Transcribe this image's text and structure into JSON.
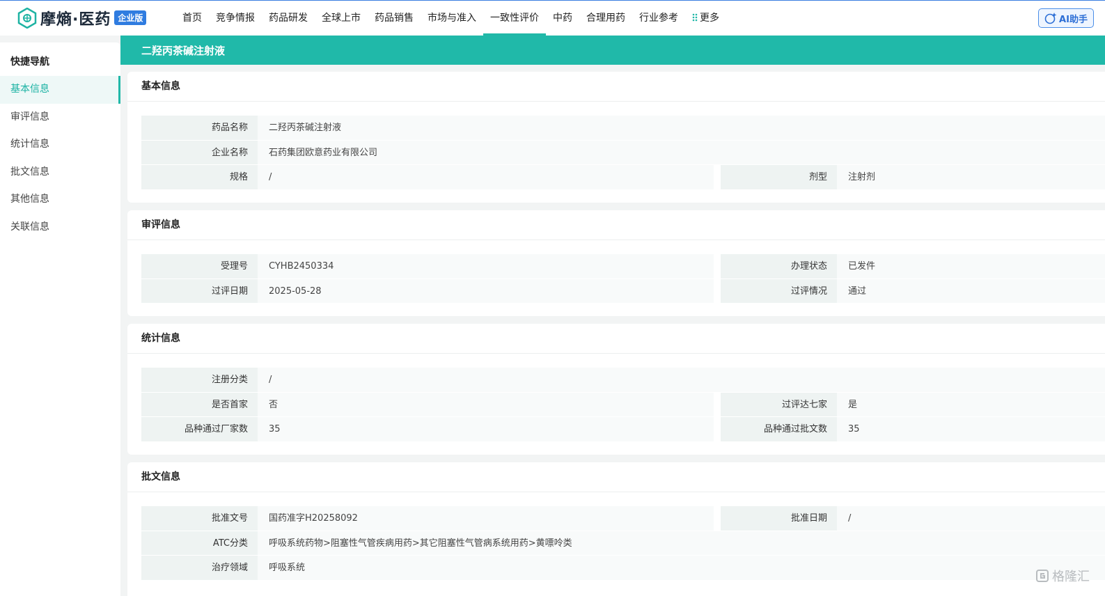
{
  "brand": {
    "name": "摩熵·医药",
    "badge": "企业版"
  },
  "nav": {
    "items": [
      "首页",
      "竞争情报",
      "药品研发",
      "全球上市",
      "药品销售",
      "市场与准入",
      "一致性评价",
      "中药",
      "合理用药",
      "行业参考"
    ],
    "more": "更多",
    "ai_label": "AI助手"
  },
  "sidebar": {
    "title": "快捷导航",
    "items": [
      "基本信息",
      "审评信息",
      "统计信息",
      "批文信息",
      "其他信息",
      "关联信息"
    ]
  },
  "page_title": "二羟丙茶碱注射液",
  "sections": {
    "basic": {
      "title": "基本信息",
      "drug_name_label": "药品名称",
      "drug_name": "二羟丙茶碱注射液",
      "company_label": "企业名称",
      "company": "石药集团欧意药业有限公司",
      "spec_label": "规格",
      "spec": "/",
      "form_label": "剂型",
      "form": "注射剂"
    },
    "review": {
      "title": "审评信息",
      "acceptance_label": "受理号",
      "acceptance": "CYHB2450334",
      "status_label": "办理状态",
      "status": "已发件",
      "date_label": "过评日期",
      "date": "2025-05-28",
      "result_label": "过评情况",
      "result": "通过"
    },
    "stats": {
      "title": "统计信息",
      "reg_class_label": "注册分类",
      "reg_class": "/",
      "first_label": "是否首家",
      "first": "否",
      "seven_label": "过评达七家",
      "seven": "是",
      "makers_label": "品种通过厂家数",
      "makers": "35",
      "approvals_label": "品种通过批文数",
      "approvals": "35"
    },
    "approval": {
      "title": "批文信息",
      "number_label": "批准文号",
      "number": "国药准字H20258092",
      "approve_date_label": "批准日期",
      "approve_date": "/",
      "atc_label": "ATC分类",
      "atc": "呼吸系统药物>阻塞性气管疾病用药>其它阻塞性气管病系统用药>黄嘌呤类",
      "area_label": "治疗领域",
      "area": "呼吸系统"
    }
  },
  "watermark": "格隆汇",
  "colors": {
    "accent": "#20b9a9",
    "brand_blue": "#2f7ce0"
  }
}
